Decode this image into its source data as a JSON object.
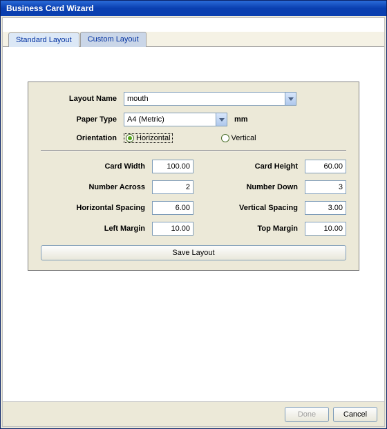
{
  "window": {
    "title": "Business Card Wizard"
  },
  "tabs": {
    "standard": "Standard Layout",
    "custom": "Custom Layout",
    "active": "custom"
  },
  "form": {
    "labels": {
      "layout_name": "Layout Name",
      "paper_type": "Paper Type",
      "orientation": "Orientation",
      "card_width": "Card Width",
      "card_height": "Card Height",
      "number_across": "Number Across",
      "number_down": "Number Down",
      "horizontal_spacing": "Horizontal Spacing",
      "vertical_spacing": "Vertical Spacing",
      "left_margin": "Left Margin",
      "top_margin": "Top Margin"
    },
    "layout_name": "mouth",
    "paper_type": "A4 (Metric)",
    "paper_unit": "mm",
    "orientation": {
      "options": {
        "horizontal": "Horizontal",
        "vertical": "Vertical"
      },
      "selected": "horizontal"
    },
    "card_width": "100.00",
    "card_height": "60.00",
    "number_across": "2",
    "number_down": "3",
    "horizontal_spacing": "6.00",
    "vertical_spacing": "3.00",
    "left_margin": "10.00",
    "top_margin": "10.00",
    "save_button": "Save Layout"
  },
  "footer": {
    "done": "Done",
    "done_enabled": false,
    "cancel": "Cancel"
  }
}
